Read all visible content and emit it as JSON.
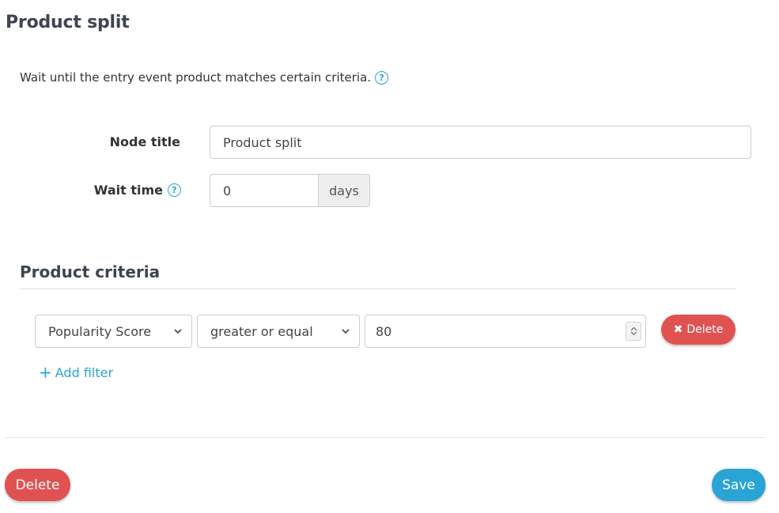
{
  "page": {
    "title": "Product split",
    "description": "Wait until the entry event product matches certain criteria."
  },
  "icons": {
    "help": "?",
    "delete_x": "✖",
    "plus": "+"
  },
  "form": {
    "node_title_label": "Node title",
    "node_title_value": "Product split",
    "wait_time_label": "Wait time",
    "wait_time_value": "0",
    "wait_time_unit": "days"
  },
  "criteria": {
    "section_title": "Product criteria",
    "filters": [
      {
        "field": "Popularity Score",
        "operator": "greater or equal",
        "value": "80",
        "delete_label": "Delete"
      }
    ],
    "add_filter_label": "Add filter"
  },
  "footer": {
    "delete_label": "Delete",
    "save_label": "Save"
  },
  "colors": {
    "primary": "#2aa4d5",
    "danger": "#e05252"
  }
}
